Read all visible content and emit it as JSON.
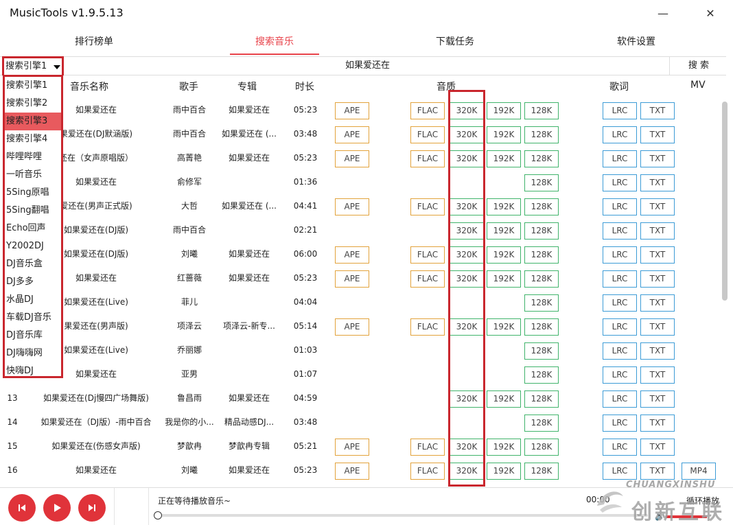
{
  "app": {
    "title": "MusicTools v1.9.5.13",
    "minimize": "—",
    "close": "✕"
  },
  "tabs": [
    {
      "label": "排行榜单",
      "active": false
    },
    {
      "label": "搜索音乐",
      "active": true
    },
    {
      "label": "下载任务",
      "active": false
    },
    {
      "label": "软件设置",
      "active": false
    }
  ],
  "search": {
    "engine": "搜索引擎1",
    "query": "如果爱还在",
    "button": "搜 索"
  },
  "columns": {
    "name": "音乐名称",
    "artist": "歌手",
    "album": "专辑",
    "duration": "时长",
    "quality": "音质",
    "lyrics": "歌词",
    "mv": "MV"
  },
  "engines": {
    "selected_index": 2,
    "items": [
      "搜索引擎1",
      "搜索引擎2",
      "搜索引擎3",
      "搜索引擎4",
      "哔哩哔哩",
      "一听音乐",
      "5Sing原唱",
      "5Sing翻唱",
      "Echo回声",
      "Y2002DJ",
      "DJ音乐盒",
      "DJ多多",
      "水晶DJ",
      "车载DJ音乐",
      "DJ音乐库",
      "DJ嗨嗨网",
      "快嗨DJ"
    ]
  },
  "labels": {
    "ape": "APE",
    "flac": "FLAC",
    "q320": "320K",
    "q192": "192K",
    "q128": "128K",
    "lrc": "LRC",
    "txt": "TXT",
    "mp4": "MP4"
  },
  "rows": [
    {
      "num": "",
      "name": "如果爱还在",
      "artist": "雨中百合",
      "album": "如果爱还在",
      "duration": "05:23",
      "ape": true,
      "flac": true,
      "q320": true,
      "q192": true,
      "q128": true,
      "mp4": false
    },
    {
      "num": "",
      "name": "果爱还在(DJ默涵版)",
      "artist": "雨中百合",
      "album": "如果爱还在 (...",
      "duration": "03:48",
      "ape": true,
      "flac": true,
      "q320": true,
      "q192": true,
      "q128": true,
      "mp4": false
    },
    {
      "num": "",
      "name": "还在（女声原唱版）",
      "artist": "高菁艳",
      "album": "如果爱还在",
      "duration": "05:23",
      "ape": true,
      "flac": true,
      "q320": true,
      "q192": true,
      "q128": true,
      "mp4": false
    },
    {
      "num": "",
      "name": "如果爱还在",
      "artist": "俞修军",
      "album": "",
      "duration": "01:36",
      "ape": false,
      "flac": false,
      "q320": false,
      "q192": false,
      "q128": true,
      "mp4": false
    },
    {
      "num": "",
      "name": "爱还在(男声正式版)",
      "artist": "大哲",
      "album": "如果爱还在 (...",
      "duration": "04:41",
      "ape": true,
      "flac": true,
      "q320": true,
      "q192": true,
      "q128": true,
      "mp4": false
    },
    {
      "num": "",
      "name": "如果爱还在(DJ版)",
      "artist": "雨中百合",
      "album": "",
      "duration": "02:21",
      "ape": false,
      "flac": false,
      "q320": true,
      "q192": true,
      "q128": true,
      "mp4": false
    },
    {
      "num": "",
      "name": "如果爱还在(DJ版)",
      "artist": "刘曦",
      "album": "如果爱还在",
      "duration": "06:00",
      "ape": true,
      "flac": true,
      "q320": true,
      "q192": true,
      "q128": true,
      "mp4": false
    },
    {
      "num": "",
      "name": "如果爱还在",
      "artist": "红蔷薇",
      "album": "如果爱还在",
      "duration": "05:23",
      "ape": true,
      "flac": true,
      "q320": true,
      "q192": true,
      "q128": true,
      "mp4": false
    },
    {
      "num": "",
      "name": "如果爱还在(Live)",
      "artist": "菲儿",
      "album": "",
      "duration": "04:04",
      "ape": false,
      "flac": false,
      "q320": false,
      "q192": false,
      "q128": true,
      "mp4": false
    },
    {
      "num": "",
      "name": "果爱还在(男声版)",
      "artist": "项泽云",
      "album": "项泽云-新专...",
      "duration": "05:14",
      "ape": true,
      "flac": true,
      "q320": true,
      "q192": true,
      "q128": true,
      "mp4": false
    },
    {
      "num": "",
      "name": "如果爱还在(Live)",
      "artist": "乔丽娜",
      "album": "",
      "duration": "01:03",
      "ape": false,
      "flac": false,
      "q320": false,
      "q192": false,
      "q128": true,
      "mp4": false
    },
    {
      "num": "",
      "name": "如果爱还在",
      "artist": "亚男",
      "album": "",
      "duration": "01:07",
      "ape": false,
      "flac": false,
      "q320": false,
      "q192": false,
      "q128": true,
      "mp4": false
    },
    {
      "num": "13",
      "name": "如果爱还在(Dj慢四广场舞版)",
      "artist": "鲁昌雨",
      "album": "如果爱还在",
      "duration": "04:59",
      "ape": false,
      "flac": false,
      "q320": true,
      "q192": true,
      "q128": true,
      "mp4": false
    },
    {
      "num": "14",
      "name": "如果爱还在（DJ版）-雨中百合",
      "artist": "我是你的小...",
      "album": "精品动感DJ...",
      "duration": "03:48",
      "ape": false,
      "flac": false,
      "q320": false,
      "q192": false,
      "q128": true,
      "mp4": false
    },
    {
      "num": "15",
      "name": "如果爱还在(伤感女声版)",
      "artist": "梦歆冉",
      "album": "梦歆冉专辑",
      "duration": "05:21",
      "ape": true,
      "flac": true,
      "q320": true,
      "q192": true,
      "q128": true,
      "mp4": false
    },
    {
      "num": "16",
      "name": "如果爱还在",
      "artist": "刘曦",
      "album": "如果爱还在",
      "duration": "05:23",
      "ape": true,
      "flac": true,
      "q320": true,
      "q192": true,
      "q128": true,
      "mp4": true
    }
  ],
  "player": {
    "status": "正在等待播放音乐~",
    "time": "00:00",
    "mode": "循环播放"
  },
  "watermark": {
    "top": "CHUANGXINSHU",
    "bottom": "创新互联"
  },
  "colors": {
    "accent": "#e0333a",
    "orange_border": "#e2a23a",
    "green_border": "#3fb36a",
    "blue_border": "#3b9bd6",
    "highlight_red": "#c9262d"
  }
}
